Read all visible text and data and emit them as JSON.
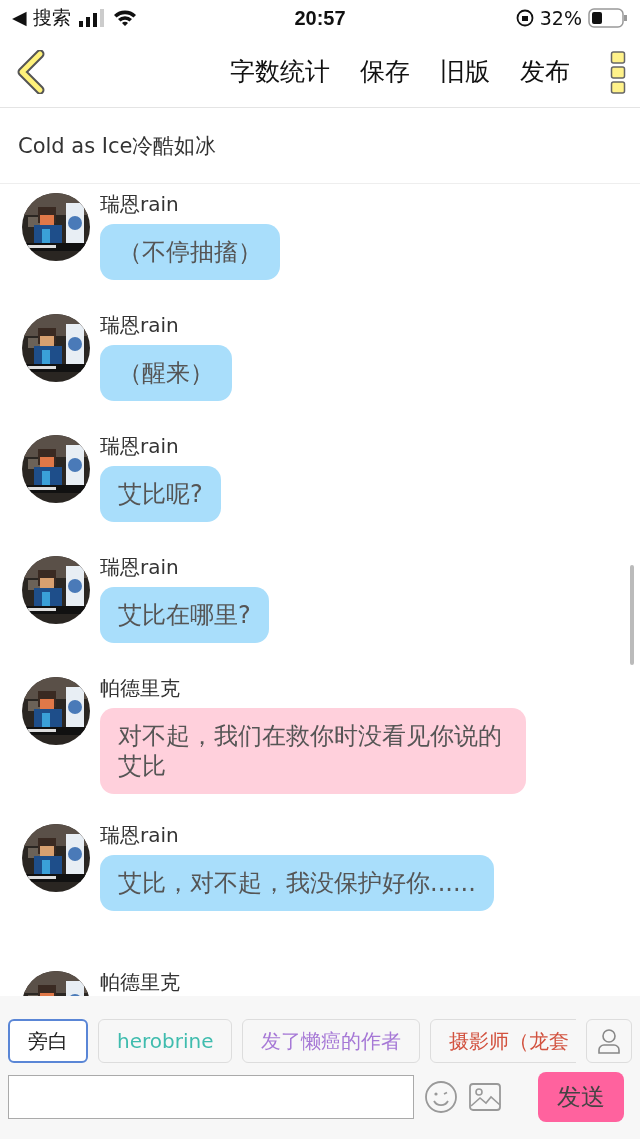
{
  "status_bar": {
    "back_label": "◀ 搜索",
    "time": "20:57",
    "battery": "32%"
  },
  "toolbar": {
    "actions": [
      "字数统计",
      "保存",
      "旧版",
      "发布"
    ]
  },
  "story_title": "Cold as Ice冷酷如冰",
  "messages": [
    {
      "name": "瑞恩rain",
      "text": "（不停抽搐）",
      "color": "#a9defb"
    },
    {
      "name": "瑞恩rain",
      "text": "（醒来）",
      "color": "#a9defb"
    },
    {
      "name": "瑞恩rain",
      "text": "艾比呢?",
      "color": "#a9defb"
    },
    {
      "name": "瑞恩rain",
      "text": "艾比在哪里?",
      "color": "#a9defb"
    },
    {
      "name": "帕德里克",
      "text": "对不起，我们在救你时没看见你说的艾比",
      "color": "#ffd0dc"
    },
    {
      "name": "瑞恩rain",
      "text": "艾比，对不起，我没保护好你......",
      "color": "#a9defb"
    },
    {
      "name": "帕德里克"
    }
  ],
  "characters": [
    {
      "label": "旁白",
      "color": "#222222",
      "selected": true
    },
    {
      "label": "herobrine",
      "color": "#3fbcae",
      "selected": false
    },
    {
      "label": "发了懒癌的作者",
      "color": "#a678d6",
      "selected": false
    },
    {
      "label": "摄影师（龙套",
      "color": "#d2523f",
      "selected": false
    }
  ],
  "send_label": "发送"
}
